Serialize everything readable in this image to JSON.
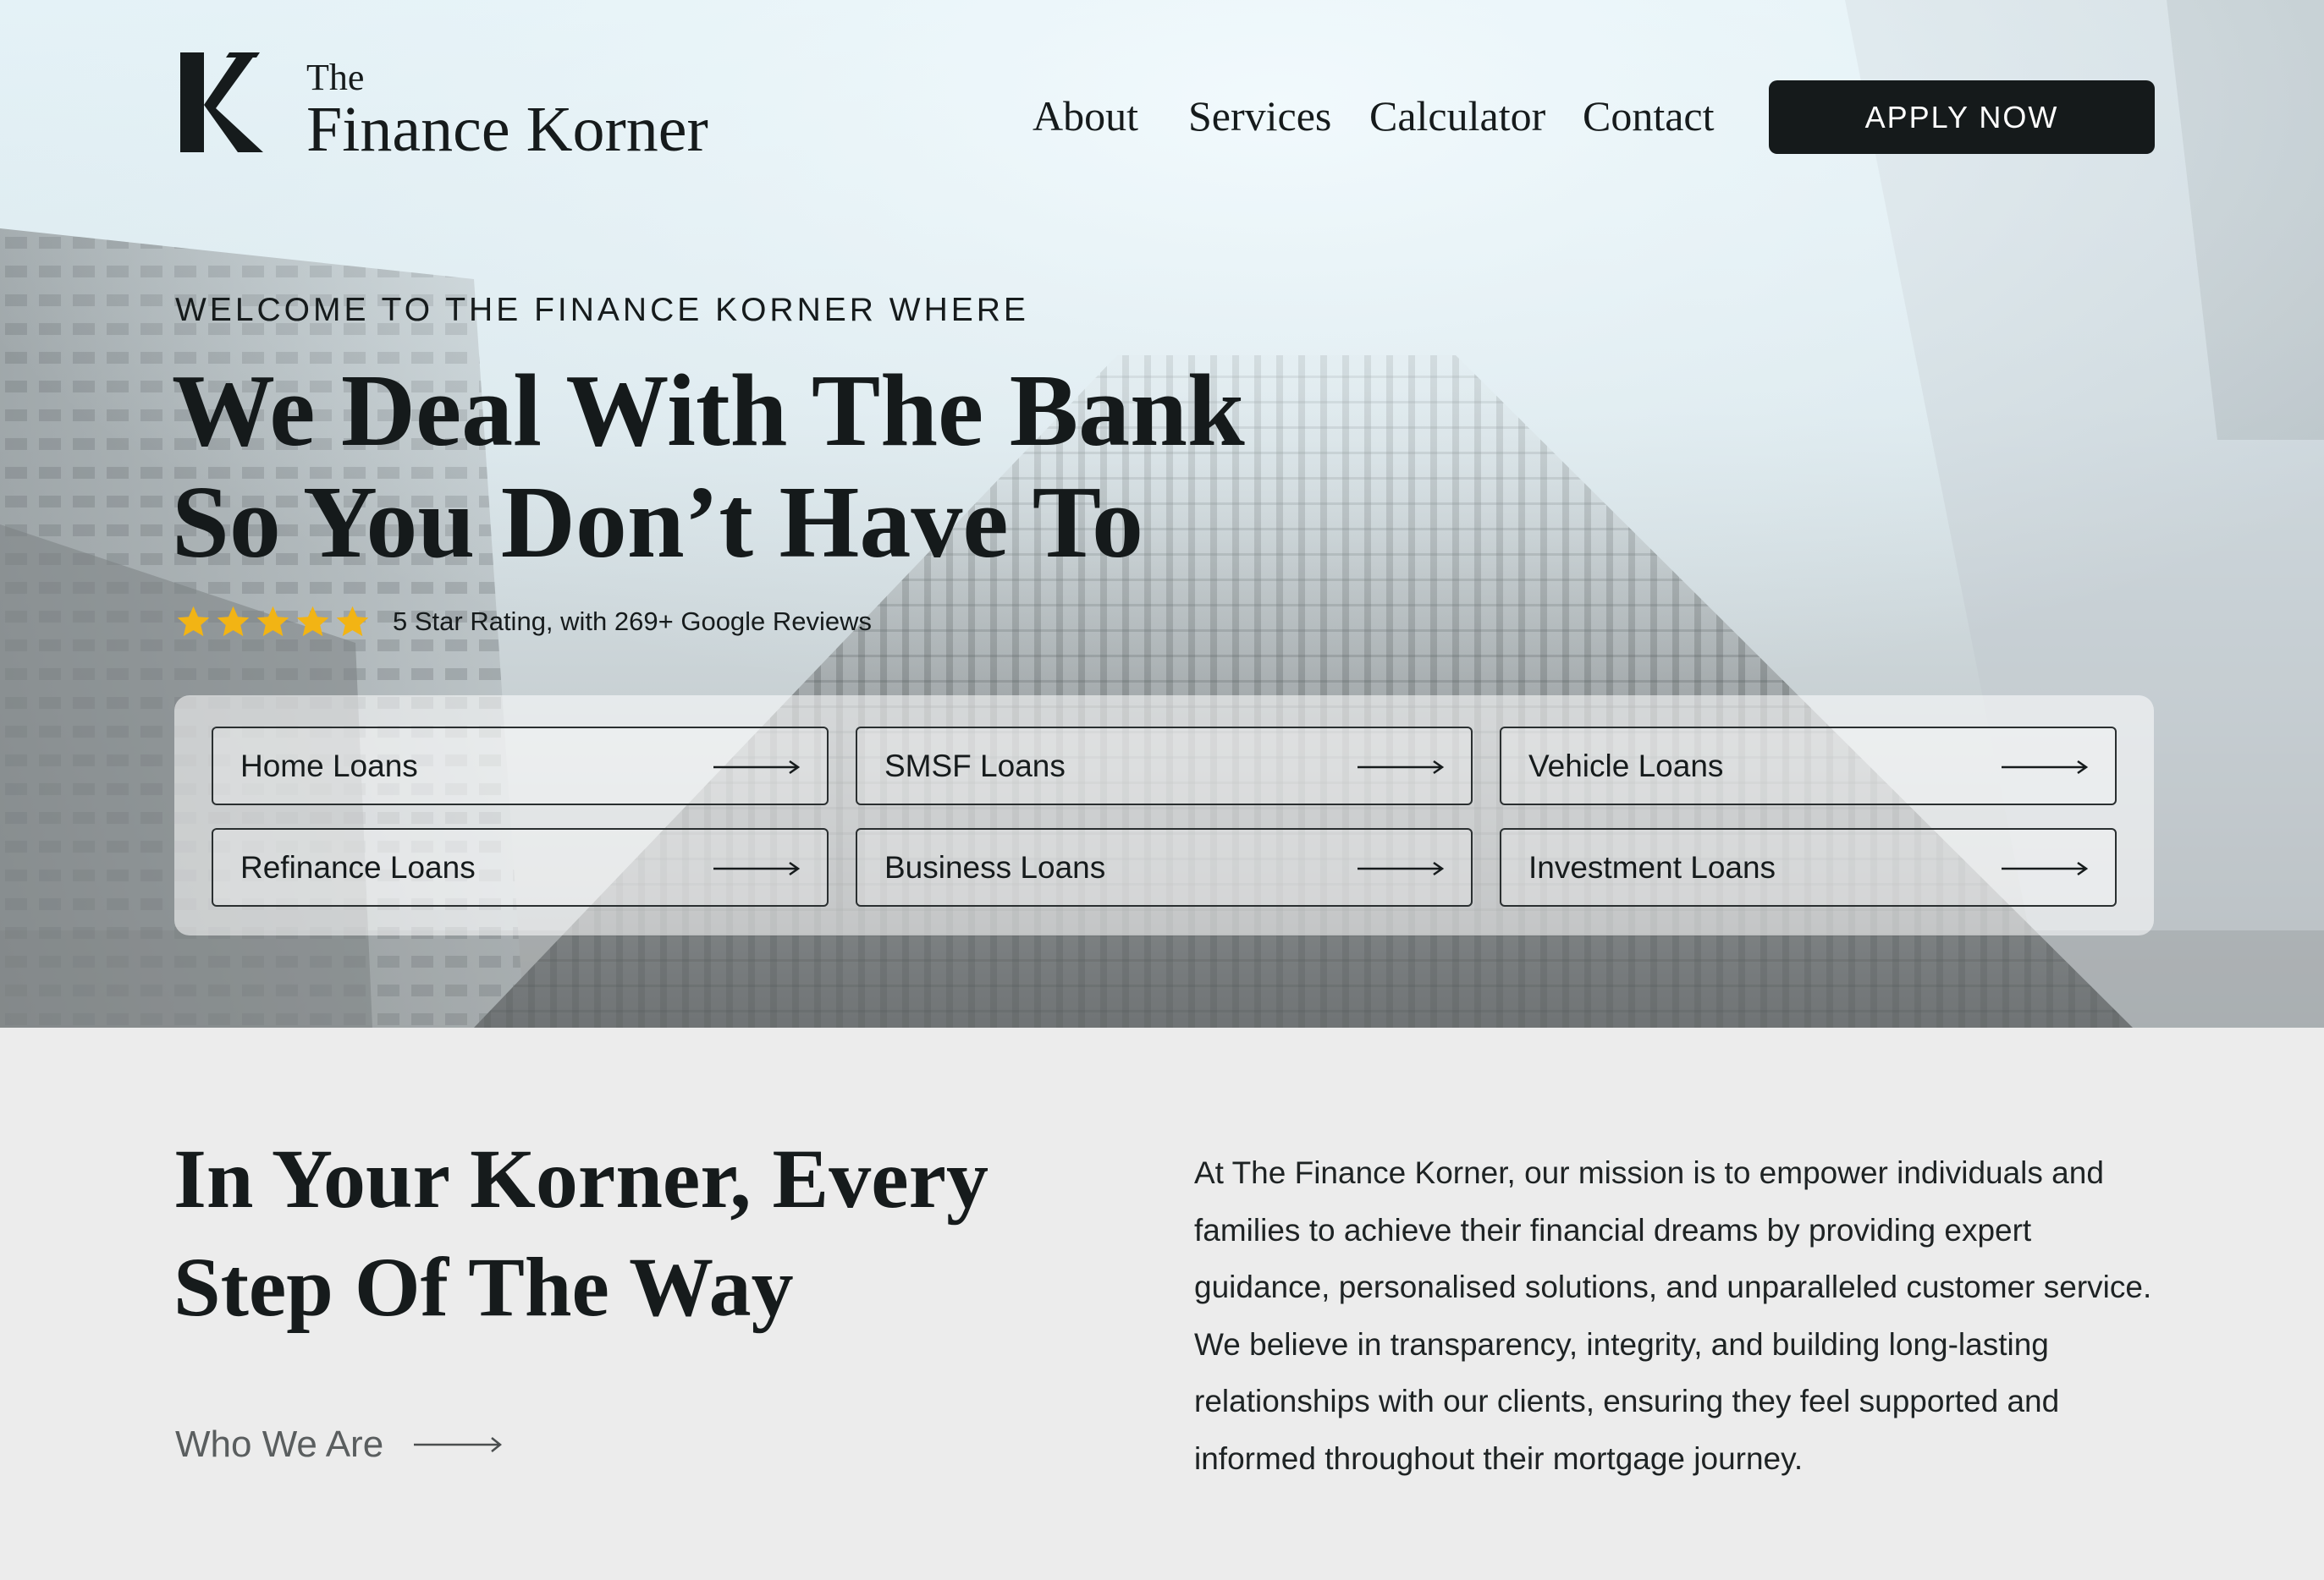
{
  "brand": {
    "logo_line1": "The",
    "logo_line2": "Finance Korner"
  },
  "nav": {
    "items": [
      "About",
      "Services",
      "Calculator",
      "Contact"
    ],
    "apply_label": "APPLY NOW"
  },
  "hero": {
    "eyebrow": "WELCOME TO THE FINANCE KORNER WHERE",
    "headline_line1": "We Deal With The Bank",
    "headline_line2": "So You Don’t Have To",
    "rating_stars": 5,
    "rating_text": "5 Star Rating, with 269+ Google Reviews",
    "star_color": "#f2b414"
  },
  "loans": [
    {
      "label": "Home Loans"
    },
    {
      "label": "SMSF Loans"
    },
    {
      "label": "Vehicle Loans"
    },
    {
      "label": "Refinance Loans"
    },
    {
      "label": "Business Loans"
    },
    {
      "label": "Investment Loans"
    }
  ],
  "about": {
    "title_line1": "In Your Korner, Every",
    "title_line2": "Step Of The Way",
    "link_label": "Who We Are",
    "paragraph": "At The Finance Korner, our mission is to empower individuals and families to achieve their financial dreams by providing expert guidance, personalised solutions, and unparalleled customer service. We believe in transparency, integrity, and building long-lasting relationships with our clients, ensuring they feel supported and informed throughout their mortgage journey."
  },
  "colors": {
    "dark": "#151a1b",
    "section_bg": "#ececec",
    "star": "#f2b414"
  }
}
